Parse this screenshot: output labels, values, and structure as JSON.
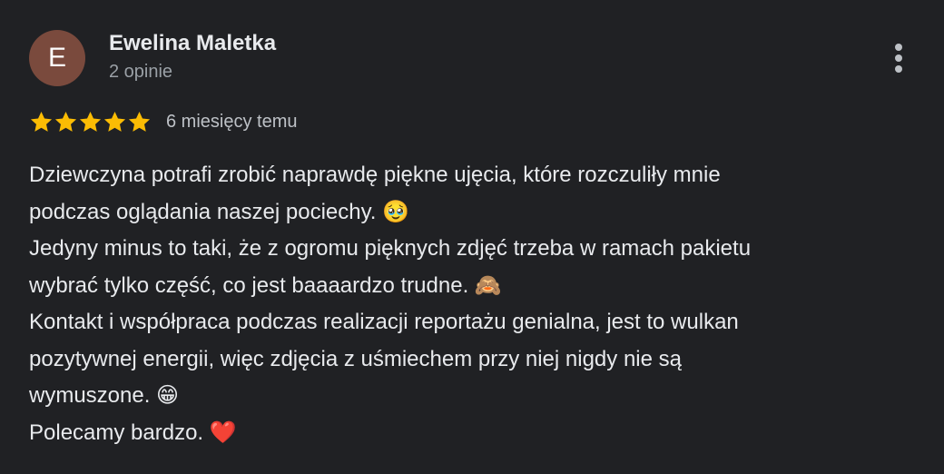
{
  "review": {
    "avatar_letter": "E",
    "avatar_color": "#7a4a3d",
    "author_name": "Ewelina Maletka",
    "author_meta": "2 opinie",
    "rating": 5,
    "rating_max": 5,
    "star_color": "#fbbc04",
    "time_ago": "6 miesięcy temu",
    "more_icon": "more-vert-icon",
    "text_lines": [
      "Dziewczyna potrafi zrobić naprawdę piękne ujęcia, które rozczuliły mnie",
      "podczas oglądania naszej pociechy. 🥹",
      "Jedyny minus to taki, że z ogromu pięknych zdjęć trzeba w ramach pakietu",
      "wybrać tylko część, co jest baaaardzo trudne. 🙈",
      "Kontakt i współpraca podczas realizacji reportażu genialna, jest to wulkan",
      "pozytywnej energii, więc zdjęcia z uśmiechem przy niej nigdy nie są",
      "wymuszone. 😁",
      "Polecamy bardzo. ❤️"
    ]
  }
}
